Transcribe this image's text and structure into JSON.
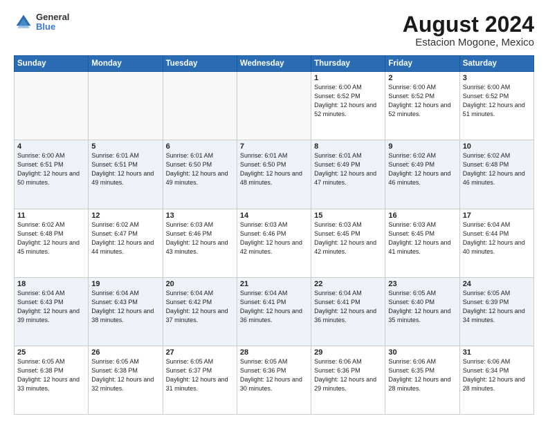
{
  "logo": {
    "line1": "General",
    "line2": "Blue"
  },
  "title": "August 2024",
  "subtitle": "Estacion Mogone, Mexico",
  "days_of_week": [
    "Sunday",
    "Monday",
    "Tuesday",
    "Wednesday",
    "Thursday",
    "Friday",
    "Saturday"
  ],
  "weeks": [
    [
      {
        "day": "",
        "info": ""
      },
      {
        "day": "",
        "info": ""
      },
      {
        "day": "",
        "info": ""
      },
      {
        "day": "",
        "info": ""
      },
      {
        "day": "1",
        "info": "Sunrise: 6:00 AM\nSunset: 6:52 PM\nDaylight: 12 hours\nand 52 minutes."
      },
      {
        "day": "2",
        "info": "Sunrise: 6:00 AM\nSunset: 6:52 PM\nDaylight: 12 hours\nand 52 minutes."
      },
      {
        "day": "3",
        "info": "Sunrise: 6:00 AM\nSunset: 6:52 PM\nDaylight: 12 hours\nand 51 minutes."
      }
    ],
    [
      {
        "day": "4",
        "info": "Sunrise: 6:00 AM\nSunset: 6:51 PM\nDaylight: 12 hours\nand 50 minutes."
      },
      {
        "day": "5",
        "info": "Sunrise: 6:01 AM\nSunset: 6:51 PM\nDaylight: 12 hours\nand 49 minutes."
      },
      {
        "day": "6",
        "info": "Sunrise: 6:01 AM\nSunset: 6:50 PM\nDaylight: 12 hours\nand 49 minutes."
      },
      {
        "day": "7",
        "info": "Sunrise: 6:01 AM\nSunset: 6:50 PM\nDaylight: 12 hours\nand 48 minutes."
      },
      {
        "day": "8",
        "info": "Sunrise: 6:01 AM\nSunset: 6:49 PM\nDaylight: 12 hours\nand 47 minutes."
      },
      {
        "day": "9",
        "info": "Sunrise: 6:02 AM\nSunset: 6:49 PM\nDaylight: 12 hours\nand 46 minutes."
      },
      {
        "day": "10",
        "info": "Sunrise: 6:02 AM\nSunset: 6:48 PM\nDaylight: 12 hours\nand 46 minutes."
      }
    ],
    [
      {
        "day": "11",
        "info": "Sunrise: 6:02 AM\nSunset: 6:48 PM\nDaylight: 12 hours\nand 45 minutes."
      },
      {
        "day": "12",
        "info": "Sunrise: 6:02 AM\nSunset: 6:47 PM\nDaylight: 12 hours\nand 44 minutes."
      },
      {
        "day": "13",
        "info": "Sunrise: 6:03 AM\nSunset: 6:46 PM\nDaylight: 12 hours\nand 43 minutes."
      },
      {
        "day": "14",
        "info": "Sunrise: 6:03 AM\nSunset: 6:46 PM\nDaylight: 12 hours\nand 42 minutes."
      },
      {
        "day": "15",
        "info": "Sunrise: 6:03 AM\nSunset: 6:45 PM\nDaylight: 12 hours\nand 42 minutes."
      },
      {
        "day": "16",
        "info": "Sunrise: 6:03 AM\nSunset: 6:45 PM\nDaylight: 12 hours\nand 41 minutes."
      },
      {
        "day": "17",
        "info": "Sunrise: 6:04 AM\nSunset: 6:44 PM\nDaylight: 12 hours\nand 40 minutes."
      }
    ],
    [
      {
        "day": "18",
        "info": "Sunrise: 6:04 AM\nSunset: 6:43 PM\nDaylight: 12 hours\nand 39 minutes."
      },
      {
        "day": "19",
        "info": "Sunrise: 6:04 AM\nSunset: 6:43 PM\nDaylight: 12 hours\nand 38 minutes."
      },
      {
        "day": "20",
        "info": "Sunrise: 6:04 AM\nSunset: 6:42 PM\nDaylight: 12 hours\nand 37 minutes."
      },
      {
        "day": "21",
        "info": "Sunrise: 6:04 AM\nSunset: 6:41 PM\nDaylight: 12 hours\nand 36 minutes."
      },
      {
        "day": "22",
        "info": "Sunrise: 6:04 AM\nSunset: 6:41 PM\nDaylight: 12 hours\nand 36 minutes."
      },
      {
        "day": "23",
        "info": "Sunrise: 6:05 AM\nSunset: 6:40 PM\nDaylight: 12 hours\nand 35 minutes."
      },
      {
        "day": "24",
        "info": "Sunrise: 6:05 AM\nSunset: 6:39 PM\nDaylight: 12 hours\nand 34 minutes."
      }
    ],
    [
      {
        "day": "25",
        "info": "Sunrise: 6:05 AM\nSunset: 6:38 PM\nDaylight: 12 hours\nand 33 minutes."
      },
      {
        "day": "26",
        "info": "Sunrise: 6:05 AM\nSunset: 6:38 PM\nDaylight: 12 hours\nand 32 minutes."
      },
      {
        "day": "27",
        "info": "Sunrise: 6:05 AM\nSunset: 6:37 PM\nDaylight: 12 hours\nand 31 minutes."
      },
      {
        "day": "28",
        "info": "Sunrise: 6:05 AM\nSunset: 6:36 PM\nDaylight: 12 hours\nand 30 minutes."
      },
      {
        "day": "29",
        "info": "Sunrise: 6:06 AM\nSunset: 6:36 PM\nDaylight: 12 hours\nand 29 minutes."
      },
      {
        "day": "30",
        "info": "Sunrise: 6:06 AM\nSunset: 6:35 PM\nDaylight: 12 hours\nand 28 minutes."
      },
      {
        "day": "31",
        "info": "Sunrise: 6:06 AM\nSunset: 6:34 PM\nDaylight: 12 hours\nand 28 minutes."
      }
    ]
  ]
}
